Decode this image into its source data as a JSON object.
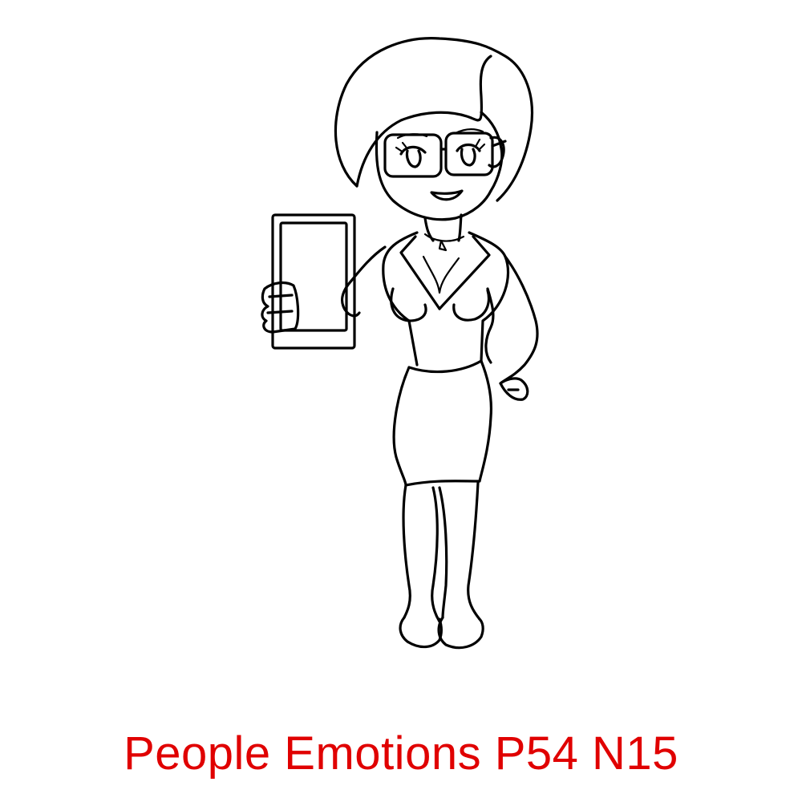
{
  "caption": {
    "text": "People Emotions P54 N15",
    "color": "#e00000"
  },
  "illustration": {
    "line_color": "#000000",
    "background_color": "#ffffff"
  }
}
